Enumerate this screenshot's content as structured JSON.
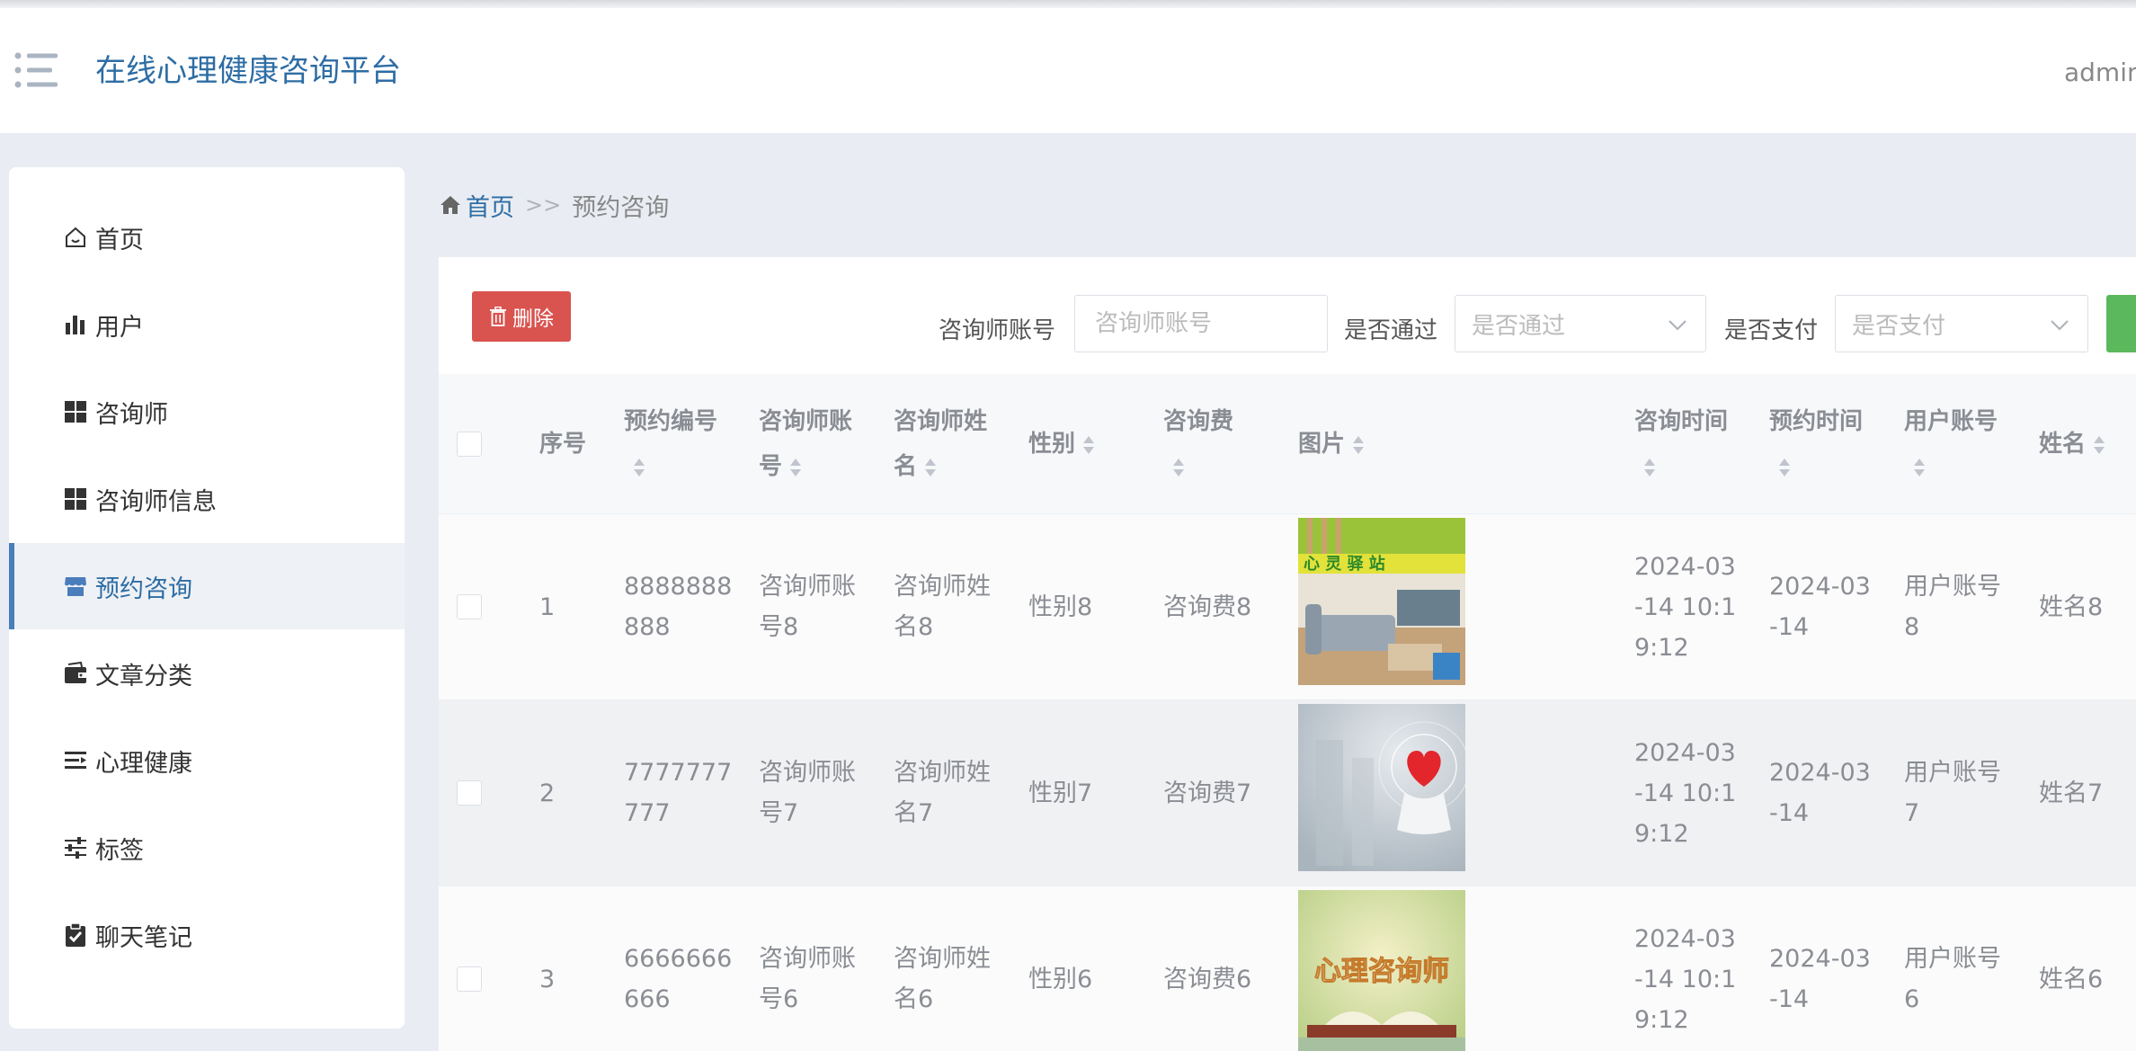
{
  "header": {
    "app_title": "在线心理健康咨询平台",
    "user": "admin"
  },
  "sidebar": {
    "items": [
      {
        "label": "首页",
        "icon": "home-icon"
      },
      {
        "label": "用户",
        "icon": "bar-chart-icon"
      },
      {
        "label": "咨询师",
        "icon": "grid-icon"
      },
      {
        "label": "咨询师信息",
        "icon": "grid-icon"
      },
      {
        "label": "预约咨询",
        "icon": "store-icon",
        "active": true
      },
      {
        "label": "文章分类",
        "icon": "wallet-icon"
      },
      {
        "label": "心理健康",
        "icon": "list-indent-icon"
      },
      {
        "label": "标签",
        "icon": "sliders-icon"
      },
      {
        "label": "聊天笔记",
        "icon": "clipboard-check-icon"
      }
    ]
  },
  "breadcrumb": {
    "home": "首页",
    "separator": ">>",
    "current": "预约咨询"
  },
  "toolbar": {
    "delete_label": "删除",
    "filters": [
      {
        "label": "咨询师账号",
        "placeholder": "咨询师账号"
      },
      {
        "label": "是否通过",
        "placeholder": "是否通过"
      },
      {
        "label": "是否支付",
        "placeholder": "是否支付"
      }
    ]
  },
  "table": {
    "columns": {
      "index": "序号",
      "booking_no": [
        "预约编号"
      ],
      "counselor_account": [
        "咨询师账",
        "号"
      ],
      "counselor_name": [
        "咨询师姓",
        "名"
      ],
      "gender": "性别",
      "fee": [
        "咨询费"
      ],
      "image": "图片",
      "consult_time": [
        "咨询时间"
      ],
      "booking_time": [
        "预约时间"
      ],
      "user_account": [
        "用户账号"
      ],
      "name": "姓名"
    },
    "rows": [
      {
        "index": "1",
        "booking_no": [
          "8888888",
          "888"
        ],
        "counselor_account": [
          "咨询师账",
          "号8"
        ],
        "counselor_name": [
          "咨询师姓",
          "名8"
        ],
        "gender": "性别8",
        "fee": "咨询费8",
        "image_text": "心 灵 驿 站",
        "consult_time": [
          "2024-03",
          "-14 10:1",
          "9:12"
        ],
        "booking_time": [
          "2024-03",
          "-14"
        ],
        "user_account": [
          "用户账号",
          "8"
        ],
        "name": "姓名8"
      },
      {
        "index": "2",
        "booking_no": [
          "7777777",
          "777"
        ],
        "counselor_account": [
          "咨询师账",
          "号7"
        ],
        "counselor_name": [
          "咨询师姓",
          "名7"
        ],
        "gender": "性别7",
        "fee": "咨询费7",
        "image_text": "",
        "consult_time": [
          "2024-03",
          "-14 10:1",
          "9:12"
        ],
        "booking_time": [
          "2024-03",
          "-14"
        ],
        "user_account": [
          "用户账号",
          "7"
        ],
        "name": "姓名7"
      },
      {
        "index": "3",
        "booking_no": [
          "6666666",
          "666"
        ],
        "counselor_account": [
          "咨询师账",
          "号6"
        ],
        "counselor_name": [
          "咨询师姓",
          "名6"
        ],
        "gender": "性别6",
        "fee": "咨询费6",
        "image_text": "心理咨询师",
        "consult_time": [
          "2024-03",
          "-14 10:1",
          "9:12"
        ],
        "booking_time": [
          "2024-03",
          "-14"
        ],
        "user_account": [
          "用户账号",
          "6"
        ],
        "name": "姓名6"
      }
    ]
  },
  "colors": {
    "accent": "#2e6da4",
    "danger": "#d9534f",
    "success": "#5cb85c",
    "active_bar": "#4a7dbb"
  }
}
